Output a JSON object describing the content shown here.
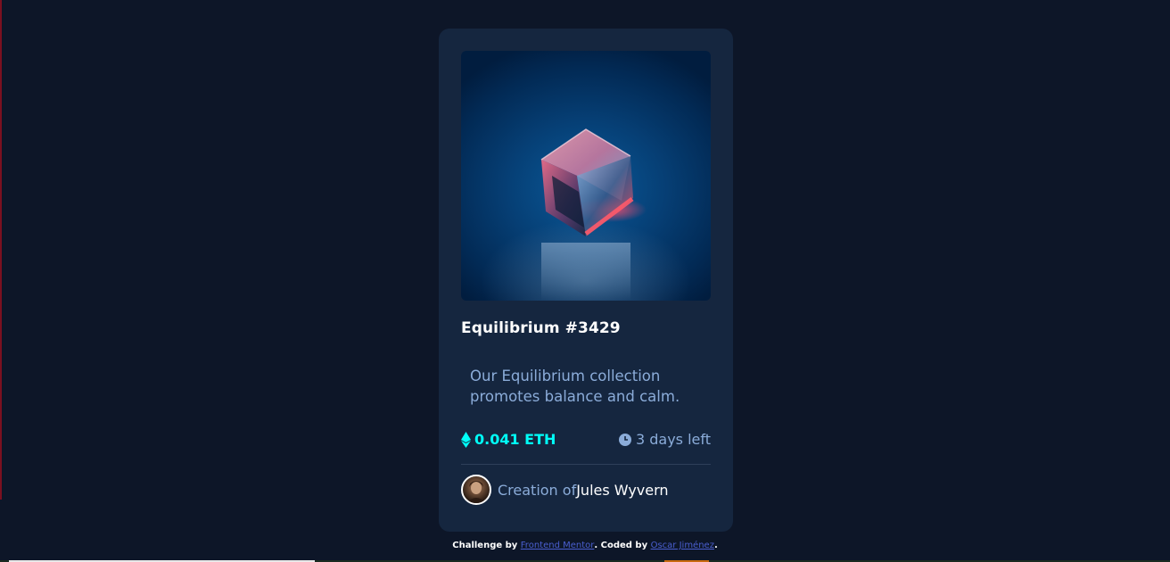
{
  "card": {
    "title": "Equilibrium #3429",
    "description": "Our Equilibrium collection promotes balance and calm.",
    "price": "0.041 ETH",
    "time_left": "3 days left",
    "creator_prefix": "Creation of",
    "creator_name": "Jules Wyvern"
  },
  "attribution": {
    "prefix": "Challenge by ",
    "link1": "Frontend Mentor",
    "middle": ". Coded by ",
    "link2": "Oscar Jiménez",
    "suffix": "."
  },
  "icons": {
    "eth": "ethereum-icon",
    "clock": "clock-icon"
  },
  "colors": {
    "background": "#0d1628",
    "card": "#15263f",
    "cyan": "#00fff8",
    "soft_blue": "#8bacd9",
    "white": "#ffffff",
    "link": "#4a5fd0"
  }
}
